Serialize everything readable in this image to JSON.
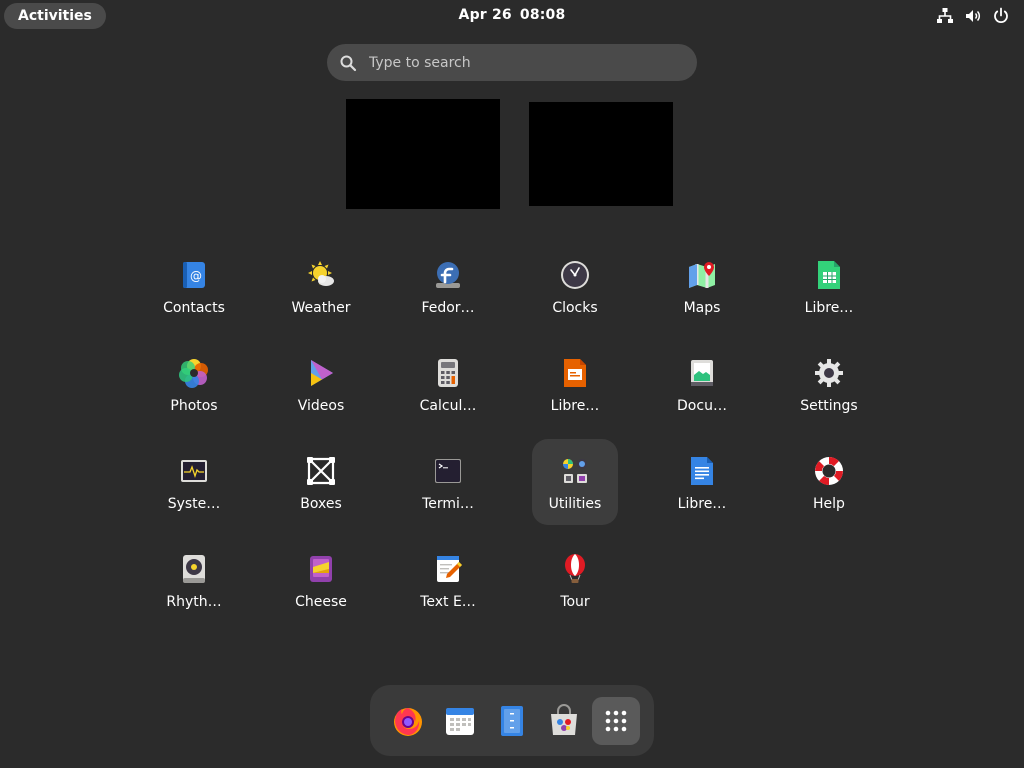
{
  "topbar": {
    "activities_label": "Activities",
    "date": "Apr 26",
    "time": "08:08",
    "status_icons": [
      "network-icon",
      "volume-icon",
      "power-icon"
    ]
  },
  "search": {
    "placeholder": "Type to search"
  },
  "apps": [
    {
      "label": "Contacts",
      "icon": "contacts-icon"
    },
    {
      "label": "Weather",
      "icon": "weather-icon"
    },
    {
      "label": "Fedor…",
      "icon": "fedora-icon"
    },
    {
      "label": "Clocks",
      "icon": "clocks-icon"
    },
    {
      "label": "Maps",
      "icon": "maps-icon"
    },
    {
      "label": "Libre…",
      "icon": "libreoffice-calc-icon"
    },
    {
      "label": "Photos",
      "icon": "photos-icon"
    },
    {
      "label": "Videos",
      "icon": "videos-icon"
    },
    {
      "label": "Calcul…",
      "icon": "calculator-icon"
    },
    {
      "label": "Libre…",
      "icon": "libreoffice-impress-icon"
    },
    {
      "label": "Docu…",
      "icon": "document-scanner-icon"
    },
    {
      "label": "Settings",
      "icon": "settings-icon"
    },
    {
      "label": "Syste…",
      "icon": "system-monitor-icon"
    },
    {
      "label": "Boxes",
      "icon": "boxes-icon"
    },
    {
      "label": "Termi…",
      "icon": "terminal-icon"
    },
    {
      "label": "Utilities",
      "icon": "utilities-folder-icon",
      "selected": true
    },
    {
      "label": "Libre…",
      "icon": "libreoffice-writer-icon"
    },
    {
      "label": "Help",
      "icon": "help-icon"
    },
    {
      "label": "Rhyth…",
      "icon": "rhythmbox-icon"
    },
    {
      "label": "Cheese",
      "icon": "cheese-icon"
    },
    {
      "label": "Text E…",
      "icon": "text-editor-icon"
    },
    {
      "label": "Tour",
      "icon": "tour-icon"
    }
  ],
  "dock": [
    {
      "icon": "firefox-icon"
    },
    {
      "icon": "calendar-icon"
    },
    {
      "icon": "files-icon"
    },
    {
      "icon": "software-icon"
    },
    {
      "icon": "show-apps-icon",
      "active": true
    }
  ],
  "colors": {
    "background": "#2b2b2b",
    "accent": "#3584e4"
  }
}
